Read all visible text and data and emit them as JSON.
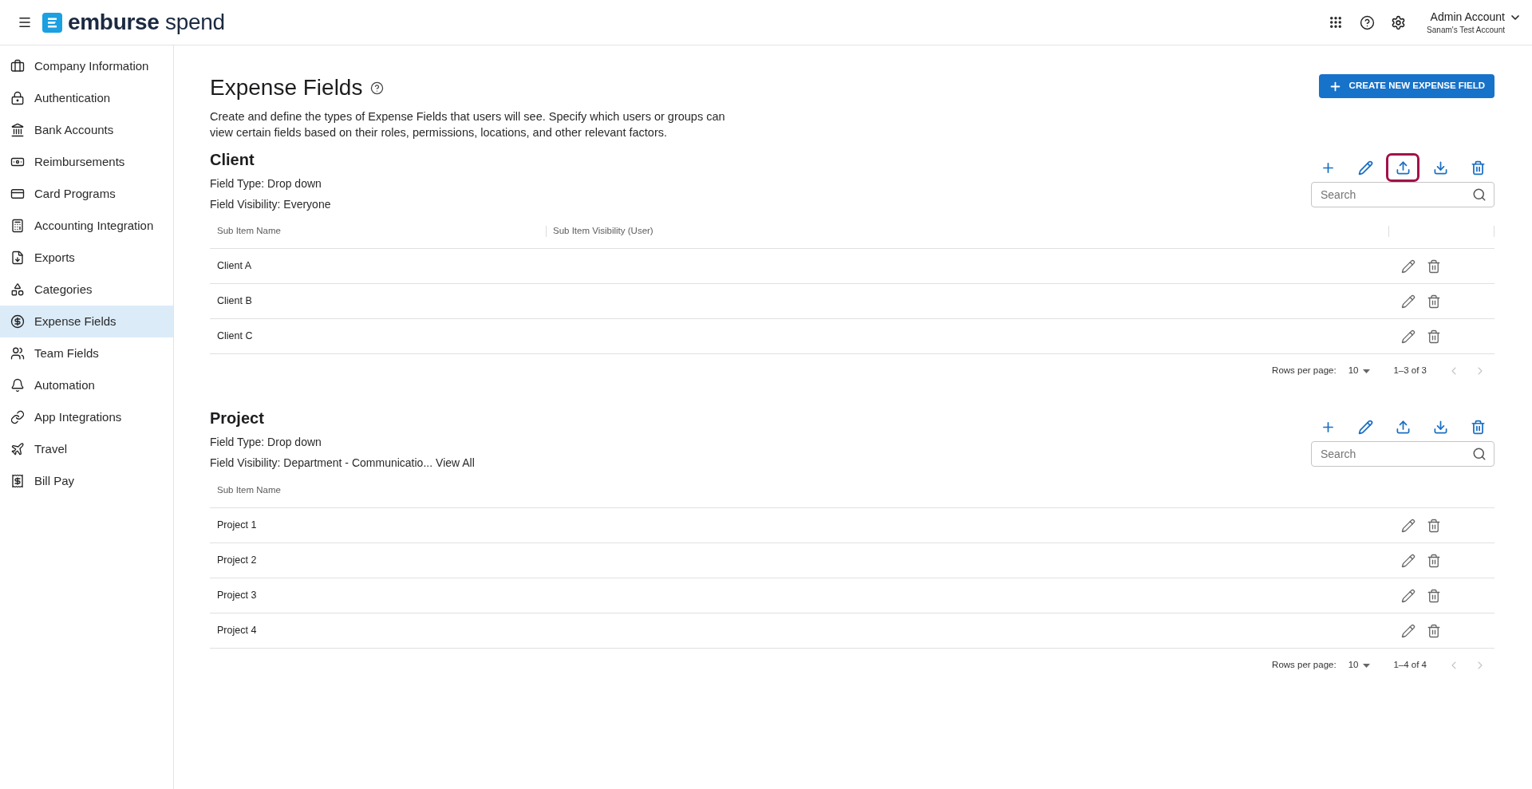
{
  "top_bar": {
    "logo_text": "**emburse** spend",
    "account": {
      "name": "Admin Account",
      "organization": "Sanam's Test Account"
    }
  },
  "sidebar": {
    "items": [
      {
        "label": "Company Information",
        "selected": false
      },
      {
        "label": "Authentication",
        "selected": false
      },
      {
        "label": "Bank Accounts",
        "selected": false
      },
      {
        "label": "Reimbursements",
        "selected": false
      },
      {
        "label": "Card Programs",
        "selected": false
      },
      {
        "label": "Accounting Integration",
        "selected": false
      },
      {
        "label": "Exports",
        "selected": false
      },
      {
        "label": "Categories",
        "selected": false
      },
      {
        "label": "Expense Fields",
        "selected": true
      },
      {
        "label": "Team Fields",
        "selected": false
      },
      {
        "label": "Automation",
        "selected": false
      },
      {
        "label": "App Integrations",
        "selected": false
      },
      {
        "label": "Travel",
        "selected": false
      },
      {
        "label": "Bill Pay",
        "selected": false
      }
    ]
  },
  "page": {
    "title": "Expense Fields",
    "description": "Create and define the types of Expense Fields that users will see. Specify which users or groups can view certain fields based on their roles, permissions, locations, and other relevant factors.",
    "create_button": "CREATE NEW EXPENSE FIELD"
  },
  "sections": [
    {
      "title": "Client",
      "field_type": "Field Type: Drop down",
      "field_visibility": "Field Visibility: Everyone",
      "toolbar": [
        {
          "kind": "add",
          "highlighted": false
        },
        {
          "kind": "edit",
          "highlighted": false
        },
        {
          "kind": "upload",
          "highlighted": true
        },
        {
          "kind": "download",
          "highlighted": false
        },
        {
          "kind": "delete",
          "highlighted": false
        }
      ],
      "search": {
        "placeholder": "Search"
      },
      "table": {
        "columns": [
          "Sub Item Name",
          "Sub Item Visibility (User)"
        ],
        "rows": [
          "Client A",
          "Client B",
          "Client C"
        ]
      },
      "pagination": {
        "label": "Rows per page:",
        "page_size": "10",
        "range": "1–3 of 3",
        "previous_disabled": true,
        "next_disabled": true
      }
    },
    {
      "title": "Project",
      "field_type": "Field Type: Drop down",
      "field_visibility": "Field Visibility: Department - Communicatio...",
      "view_all_link": "View All",
      "toolbar": [
        {
          "kind": "add",
          "highlighted": false
        },
        {
          "kind": "edit",
          "highlighted": false
        },
        {
          "kind": "upload",
          "highlighted": false
        },
        {
          "kind": "download",
          "highlighted": false
        },
        {
          "kind": "delete",
          "highlighted": false
        }
      ],
      "search": {
        "placeholder": "Search"
      },
      "table": {
        "columns": [
          "Sub Item Name"
        ],
        "rows": [
          "Project 1",
          "Project 2",
          "Project 3",
          "Project 4"
        ]
      },
      "pagination": {
        "label": "Rows per page:",
        "page_size": "10",
        "range": "1–4 of 4",
        "previous_disabled": true,
        "next_disabled": true
      }
    }
  ]
}
